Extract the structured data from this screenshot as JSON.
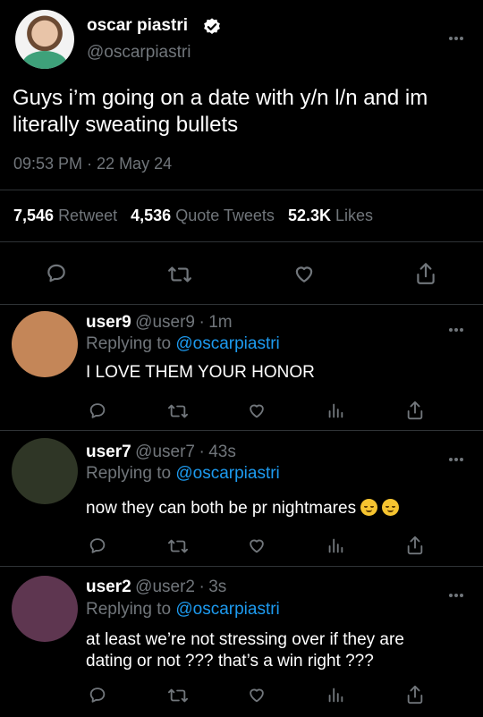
{
  "tweet": {
    "name": "oscar piastri",
    "handle": "@oscarpiastri",
    "text": "Guys i’m going on a date with y/n l/n and im literally sweating bullets",
    "time": "09:53 PM · 22 May 24",
    "stats": {
      "retweets": "7,546",
      "retweets_label": "Retweet",
      "quotes": "4,536",
      "quotes_label": "Quote Tweets",
      "likes": "52.3K",
      "likes_label": "Likes"
    }
  },
  "replies": [
    {
      "name": "user9",
      "handle": "@user9",
      "sep": "·",
      "time": "1m",
      "replying_prefix": "Replying to",
      "replying_to": "@oscarpiastri",
      "text": "I LOVE THEM YOUR HONOR",
      "avatar_color": "#c48658"
    },
    {
      "name": "user7",
      "handle": "@user7",
      "sep": "·",
      "time": "43s",
      "replying_prefix": "Replying to",
      "replying_to": "@oscarpiastri",
      "text": "now they can both be pr nightmares",
      "emoji": "relieved-face-emoji",
      "avatar_color": "#2f3626"
    },
    {
      "name": "user2",
      "handle": "@user2",
      "sep": "·",
      "time": "3s",
      "replying_prefix": "Replying to",
      "replying_to": "@oscarpiastri",
      "text_line1": "at least we’re not stressing over if they are",
      "text_line2": "dating or not ??? that’s a win right ???",
      "avatar_color": "#5e3650"
    }
  ],
  "colors": {
    "background": "#000000",
    "text": "#e7e9ea",
    "muted": "#71767b",
    "link": "#1d9bf0",
    "divider": "#2f3336"
  }
}
